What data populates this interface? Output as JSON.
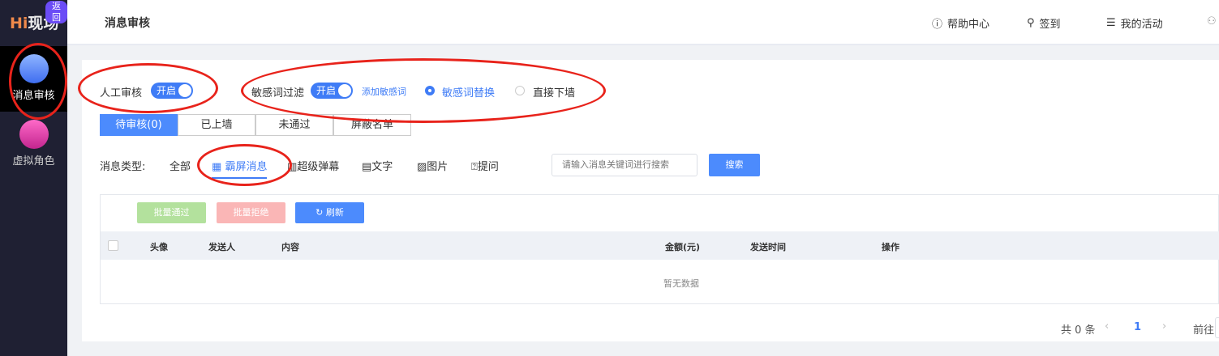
{
  "sidebar": {
    "logo": "Hi现场",
    "back": "返回",
    "items": [
      {
        "label": "消息审核"
      },
      {
        "label": "虚拟角色"
      }
    ]
  },
  "header": {
    "title": "消息审核",
    "links": [
      {
        "label": "帮助中心"
      },
      {
        "label": "签到"
      },
      {
        "label": "我的活动"
      }
    ]
  },
  "settings": {
    "manual_label": "人工审核",
    "manual_toggle": "开启",
    "filter_label": "敏感词过滤",
    "filter_toggle": "开启",
    "add_words": "添加敏感词",
    "options": [
      "敏感词替换",
      "直接下墙"
    ]
  },
  "tabs": [
    "待审核(0)",
    "已上墙",
    "未通过",
    "屏蔽名单"
  ],
  "types": {
    "label": "消息类型:",
    "items": [
      "全部",
      "霸屏消息",
      "超级弹幕",
      "文字",
      "图片",
      "提问"
    ]
  },
  "search": {
    "placeholder": "请输入消息关键词进行搜索",
    "button": "搜索"
  },
  "actions": {
    "approve": "批量通过",
    "reject": "批量拒绝",
    "refresh": "刷新"
  },
  "table": {
    "columns": [
      "头像",
      "发送人",
      "内容",
      "金额(元)",
      "发送时间",
      "操作"
    ],
    "empty": "暂无数据"
  },
  "pagination": {
    "total": "共 0 条",
    "page": "1",
    "goto": "前往"
  },
  "colors": {
    "accent": "#3f7cf6",
    "sidebar": "#1f2033"
  }
}
